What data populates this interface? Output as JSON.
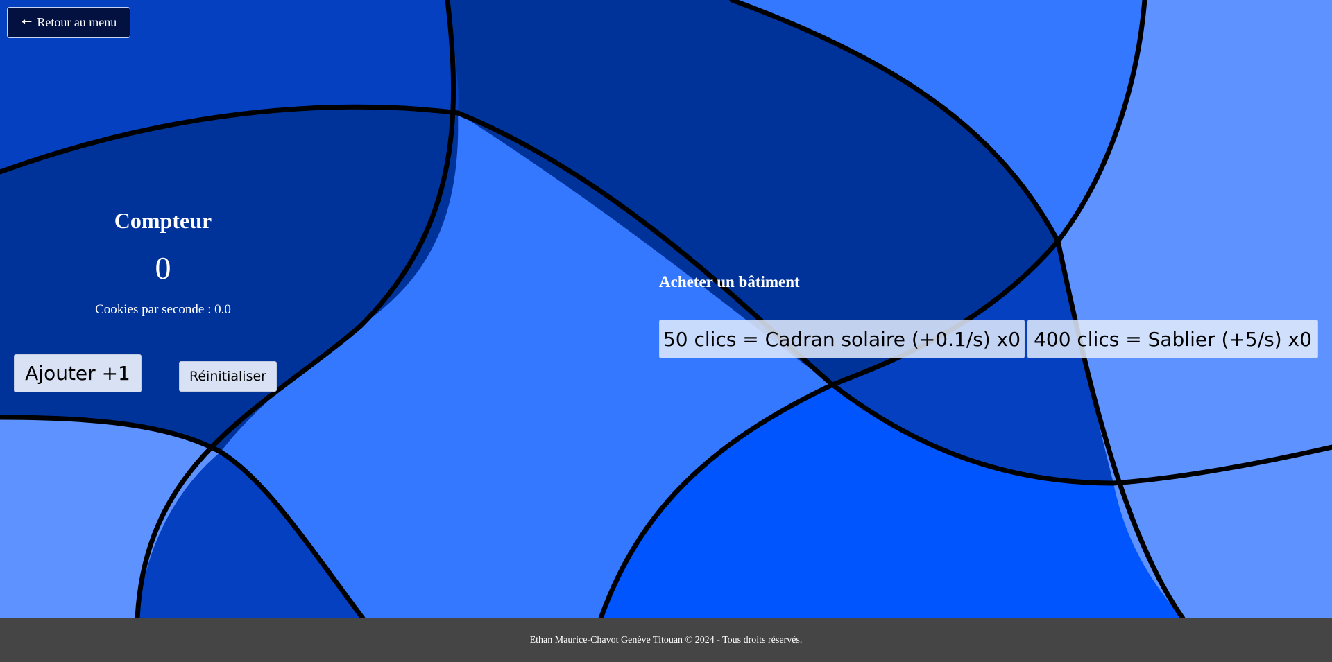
{
  "nav": {
    "back_arrow": "🠔",
    "back_label": "Retour au menu"
  },
  "counter": {
    "title": "Compteur",
    "value": "0",
    "cps_text": "Cookies par seconde : 0.0",
    "add_label": "Ajouter +1",
    "reset_label": "Réinitialiser"
  },
  "shop": {
    "title": "Acheter un bâtiment",
    "buildings": [
      {
        "label": "50 clics = Cadran solaire (+0.1/s) x0"
      },
      {
        "label": "400 clics = Sablier (+5/s) x0"
      }
    ]
  },
  "footer": {
    "text": "Ethan Maurice-Chavot Genève Titouan © 2024 - Tous droits réservés."
  },
  "colors": {
    "bg_light": "#5e92ff",
    "bg_mid": "#3478ff",
    "bg_bright": "#0055ff",
    "bg_darkblue": "#0440c0",
    "bg_navy": "#003399",
    "footer_bg": "#454545",
    "button_bg": "#d9e2f4",
    "back_button_bg": "#02113f"
  }
}
